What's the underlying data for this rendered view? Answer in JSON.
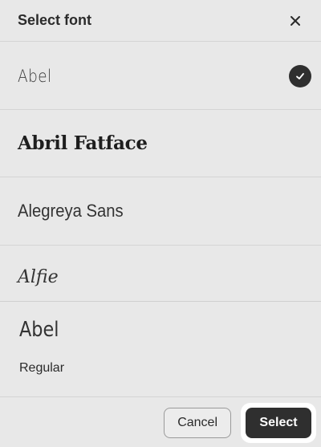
{
  "dialog": {
    "title": "Select font",
    "close_icon": "close-icon"
  },
  "fonts": [
    {
      "label": "Abel",
      "selected": true
    },
    {
      "label": "Abril Fatface",
      "selected": false
    },
    {
      "label": "Alegreya Sans",
      "selected": false
    },
    {
      "label": "Alfie",
      "selected": false
    }
  ],
  "preview": {
    "font_name": "Abel",
    "style": "Regular"
  },
  "footer": {
    "cancel_label": "Cancel",
    "select_label": "Select"
  },
  "colors": {
    "background": "#e8e8e8",
    "primary_button": "#2f2f2f",
    "check_badge": "#2f2f2f"
  }
}
